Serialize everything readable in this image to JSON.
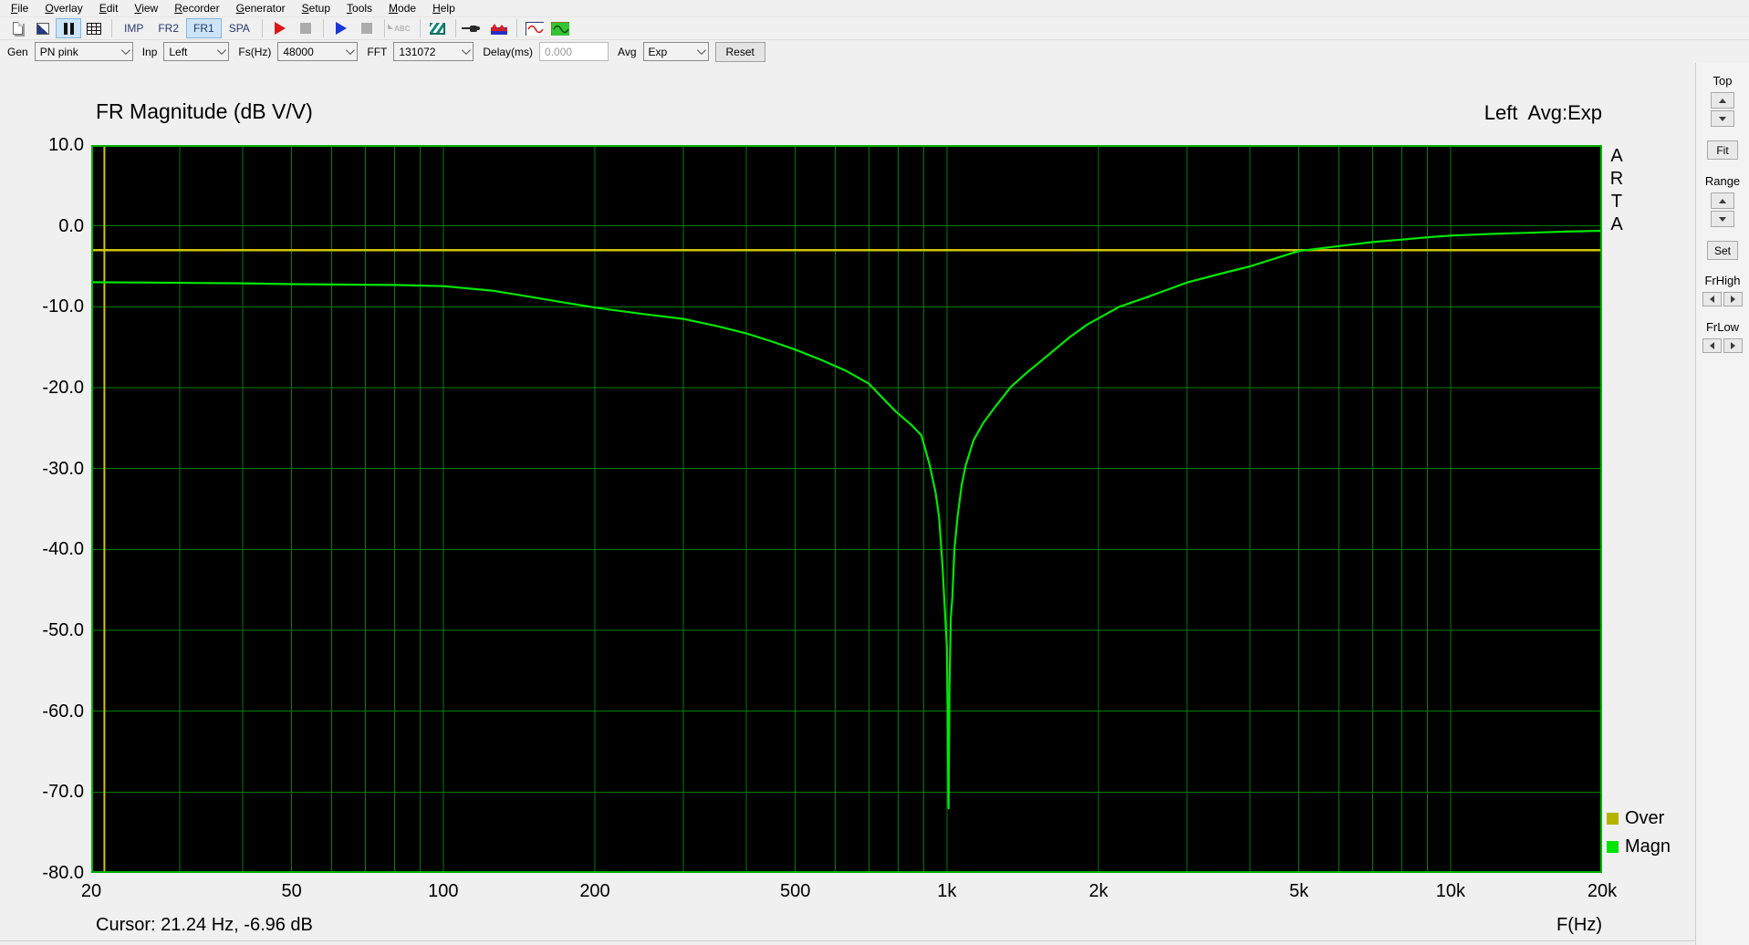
{
  "menu": {
    "items": [
      "File",
      "Overlay",
      "Edit",
      "View",
      "Recorder",
      "Generator",
      "Setup",
      "Tools",
      "Mode",
      "Help"
    ]
  },
  "toolbar": {
    "icons": [
      "new-document-icon",
      "overlay-icon",
      "pause-icon",
      "table-icon",
      "record-start-icon",
      "record-stop-icon",
      "play-icon",
      "stop-icon",
      "abc-calibrate-icon",
      "stripes-signal-icon",
      "plug-icon",
      "spectrum-mountain-icon",
      "sine-red-icon",
      "sine-green-icon"
    ],
    "active_icon": "pause-icon",
    "mode_buttons": [
      {
        "label": "IMP",
        "active": false
      },
      {
        "label": "FR2",
        "active": false
      },
      {
        "label": "FR1",
        "active": true
      },
      {
        "label": "SPA",
        "active": false
      }
    ]
  },
  "controls": {
    "gen": {
      "label": "Gen",
      "value": "PN pink"
    },
    "inp": {
      "label": "Inp",
      "value": "Left"
    },
    "fs": {
      "label": "Fs(Hz)",
      "value": "48000"
    },
    "fft": {
      "label": "FFT",
      "value": "131072"
    },
    "delay": {
      "label": "Delay(ms)",
      "value": "0.000"
    },
    "avg": {
      "label": "Avg",
      "value": "Exp"
    },
    "reset_label": "Reset"
  },
  "side_panel": {
    "top_label": "Top",
    "fit_label": "Fit",
    "range_label": "Range",
    "set_label": "Set",
    "frhigh_label": "FrHigh",
    "frlow_label": "FrLow"
  },
  "chart": {
    "title": "FR Magnitude (dB V/V)",
    "channel_info": "Left  Avg:Exp",
    "watermark": "ARTA",
    "cursor_text": "Cursor: 21.24 Hz, -6.96 dB",
    "xlabel": "F(Hz)",
    "legend": [
      {
        "label": "Over",
        "color": "#b4b400"
      },
      {
        "label": "Magn",
        "color": "#00e400"
      }
    ],
    "colors": {
      "plot_bg": "#000000",
      "grid": "#007c00",
      "border": "#00b000",
      "magn": "#00e800",
      "over": "#cfc400",
      "cursor": "#cfc400"
    }
  },
  "chart_data": {
    "type": "line",
    "title": "FR Magnitude (dB V/V)",
    "xlabel": "F(Hz)",
    "ylabel": "dB",
    "x_scale": "log",
    "xlim": [
      20,
      20000
    ],
    "ylim": [
      -80,
      10
    ],
    "grid": true,
    "legend_position": "bottom-right",
    "y_tick_labels": [
      "10.0",
      "0.0",
      "-10.0",
      "-20.0",
      "-30.0",
      "-40.0",
      "-50.0",
      "-60.0",
      "-70.0",
      "-80.0"
    ],
    "x_ticks": [
      {
        "f": 20,
        "label": "20"
      },
      {
        "f": 50,
        "label": "50"
      },
      {
        "f": 100,
        "label": "100"
      },
      {
        "f": 200,
        "label": "200"
      },
      {
        "f": 500,
        "label": "500"
      },
      {
        "f": 1000,
        "label": "1k"
      },
      {
        "f": 2000,
        "label": "2k"
      },
      {
        "f": 5000,
        "label": "5k"
      },
      {
        "f": 10000,
        "label": "10k"
      },
      {
        "f": 20000,
        "label": "20k"
      }
    ],
    "grid_freqs": [
      20,
      30,
      40,
      50,
      60,
      70,
      80,
      90,
      100,
      200,
      300,
      400,
      500,
      600,
      700,
      800,
      900,
      1000,
      2000,
      3000,
      4000,
      5000,
      6000,
      7000,
      8000,
      9000,
      10000,
      20000
    ],
    "series": [
      {
        "name": "Over",
        "color": "#cfc400",
        "width": 2.5,
        "points": [
          [
            20,
            -3.0
          ],
          [
            20000,
            -3.0
          ]
        ]
      },
      {
        "name": "Magn",
        "color": "#00e800",
        "width": 2.2,
        "points": [
          [
            20,
            -6.96
          ],
          [
            25,
            -7.0
          ],
          [
            32,
            -7.05
          ],
          [
            40,
            -7.1
          ],
          [
            50,
            -7.2
          ],
          [
            63,
            -7.25
          ],
          [
            80,
            -7.3
          ],
          [
            100,
            -7.45
          ],
          [
            125,
            -8.0
          ],
          [
            150,
            -8.8
          ],
          [
            175,
            -9.5
          ],
          [
            200,
            -10.1
          ],
          [
            250,
            -10.9
          ],
          [
            300,
            -11.5
          ],
          [
            350,
            -12.4
          ],
          [
            400,
            -13.3
          ],
          [
            450,
            -14.3
          ],
          [
            500,
            -15.3
          ],
          [
            560,
            -16.5
          ],
          [
            630,
            -17.9
          ],
          [
            700,
            -19.5
          ],
          [
            790,
            -22.9
          ],
          [
            850,
            -24.6
          ],
          [
            890,
            -25.9
          ],
          [
            925,
            -29.6
          ],
          [
            950,
            -33.0
          ],
          [
            965,
            -36.0
          ],
          [
            980,
            -42.0
          ],
          [
            990,
            -47.0
          ],
          [
            1000,
            -52.0
          ],
          [
            1004,
            -62.0
          ],
          [
            1008,
            -72.0
          ],
          [
            1012,
            -57.0
          ],
          [
            1018,
            -48.5
          ],
          [
            1025,
            -46.0
          ],
          [
            1035,
            -40.0
          ],
          [
            1050,
            -36.0
          ],
          [
            1070,
            -32.0
          ],
          [
            1090,
            -29.6
          ],
          [
            1130,
            -26.5
          ],
          [
            1180,
            -24.4
          ],
          [
            1250,
            -22.3
          ],
          [
            1340,
            -19.9
          ],
          [
            1450,
            -18.0
          ],
          [
            1580,
            -16.1
          ],
          [
            1750,
            -13.8
          ],
          [
            1900,
            -12.2
          ],
          [
            2200,
            -10.0
          ],
          [
            2500,
            -8.8
          ],
          [
            3000,
            -7.0
          ],
          [
            3500,
            -5.9
          ],
          [
            4000,
            -5.0
          ],
          [
            4500,
            -4.0
          ],
          [
            5000,
            -3.1
          ],
          [
            6000,
            -2.5
          ],
          [
            7000,
            -2.0
          ],
          [
            8000,
            -1.7
          ],
          [
            9000,
            -1.4
          ],
          [
            10000,
            -1.2
          ],
          [
            12000,
            -1.0
          ],
          [
            15000,
            -0.8
          ],
          [
            17000,
            -0.7
          ],
          [
            20000,
            -0.6
          ]
        ]
      }
    ],
    "cursor": {
      "freq_hz": 21.24,
      "db": -6.96
    }
  }
}
